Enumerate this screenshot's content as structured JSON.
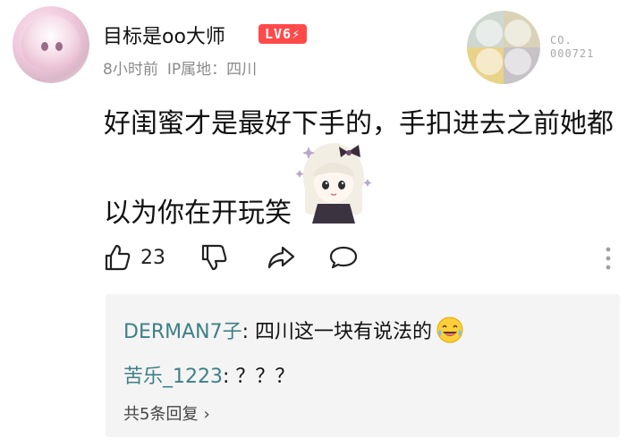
{
  "comment": {
    "user": {
      "name": "目标是oo大师",
      "level": "LV6",
      "level_badge_suffix": "⚡"
    },
    "meta": {
      "time": "8小时前",
      "ip_location": "IP属地：四川"
    },
    "decor": {
      "code_line1": "CO.",
      "code_line2": "000721"
    },
    "content": {
      "line1": "好闺蜜才是最好下手的，手扣进去之前她都",
      "line2": "以为你在开玩笑"
    },
    "actions": {
      "like_count": "23"
    },
    "replies": [
      {
        "name": "DERMAN7子",
        "sep": ": ",
        "text": "四川这一块有说法的"
      },
      {
        "name": "苦乐_1223",
        "sep": ": ",
        "text": "？？？"
      }
    ],
    "view_more": "共5条回复"
  },
  "colors": {
    "level_badge": "#ff4a4a",
    "reply_name": "#3f7f86",
    "meta_gray": "#8a8a8a",
    "reply_bg": "#f4f4f4"
  },
  "icons": {
    "like": "thumbs-up-icon",
    "dislike": "thumbs-down-icon",
    "share": "share-icon",
    "comment": "comment-icon",
    "more": "more-vertical-icon",
    "laugh_emoji": "laughing-crying-emoji-icon",
    "chevron": "chevron-right-icon"
  }
}
